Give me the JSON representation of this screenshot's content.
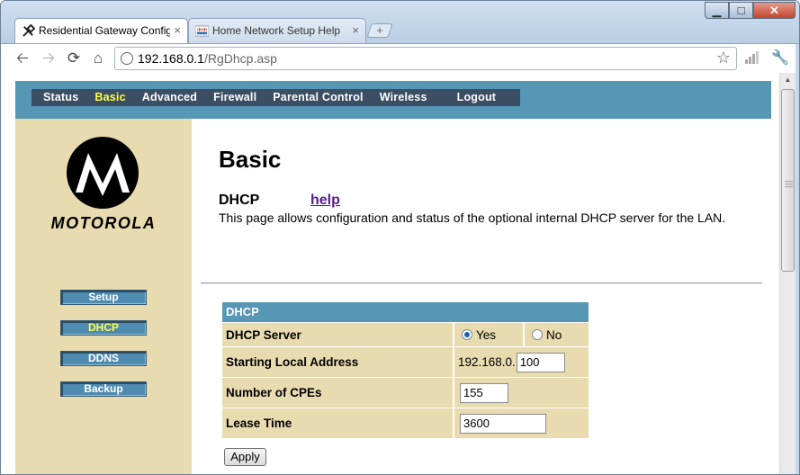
{
  "browser": {
    "tabs": [
      {
        "title": "Residential Gateway Config",
        "close": "×"
      },
      {
        "title": "Home Network Setup Help",
        "close": "×"
      }
    ],
    "new_tab": "+",
    "window_buttons": {
      "minimize": "▁",
      "maximize": "□",
      "close": "✕"
    },
    "url_host": "192.168.0.1",
    "url_path": "/RgDhcp.asp",
    "icons": [
      "back-arrow-icon",
      "forward-arrow-icon",
      "reload-icon",
      "home-icon",
      "page-icon",
      "star-icon",
      "bars-icon",
      "wrench-icon"
    ]
  },
  "top_menu": [
    {
      "label": "Status",
      "selected": false
    },
    {
      "label": "Basic",
      "selected": true
    },
    {
      "label": "Advanced",
      "selected": false
    },
    {
      "label": "Firewall",
      "selected": false
    },
    {
      "label": "Parental Control",
      "selected": false
    },
    {
      "label": "Wireless",
      "selected": false
    },
    {
      "label": "Logout",
      "selected": false
    }
  ],
  "sidebar": {
    "brand": "MOTOROLA",
    "items": [
      {
        "label": "Setup",
        "selected": false
      },
      {
        "label": "DHCP",
        "selected": true
      },
      {
        "label": "DDNS",
        "selected": false
      },
      {
        "label": "Backup",
        "selected": false
      }
    ]
  },
  "main": {
    "title": "Basic",
    "section": "DHCP",
    "help_link": "help",
    "description": "This page allows configuration and status of the optional internal DHCP server for the LAN.",
    "table": {
      "header": "DHCP",
      "rows": {
        "dhcp_server": {
          "label": "DHCP Server",
          "yes": "Yes",
          "no": "No",
          "selected": "Yes"
        },
        "starting_address": {
          "label": "Starting Local Address",
          "prefix": "192.168.0.",
          "value": "100"
        },
        "num_cpes": {
          "label": "Number of CPEs",
          "value": "155"
        },
        "lease_time": {
          "label": "Lease Time",
          "value": "3600"
        }
      }
    },
    "apply_label": "Apply"
  },
  "colors": {
    "band": "#5697b6",
    "menu_bg": "#3b4e63",
    "sidebar_bg": "#e9dbb0",
    "selected_text": "#ffff44",
    "link": "#551a8b"
  }
}
